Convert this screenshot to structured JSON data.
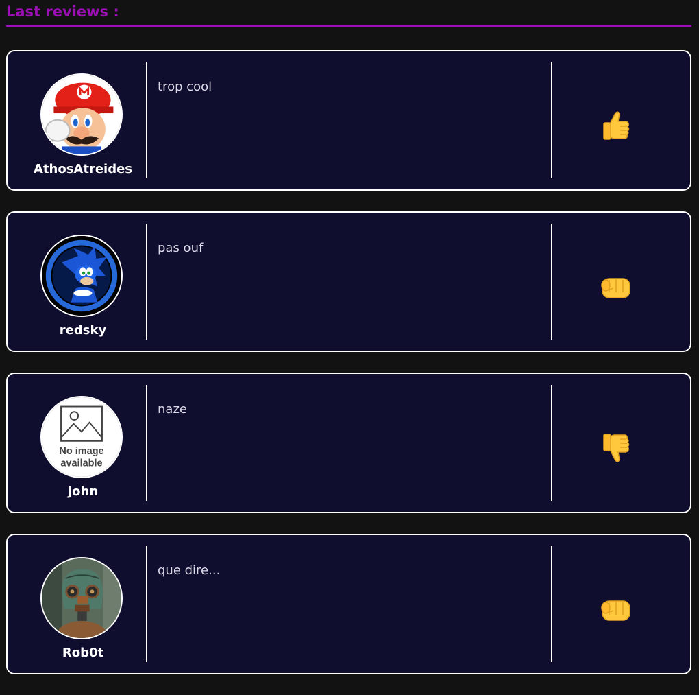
{
  "page": {
    "title": "Last reviews :",
    "accent_color": "#9c0fb6"
  },
  "reviews": [
    {
      "username": "AthosAtreides",
      "comment": "trop cool",
      "reaction_icon": "thumbs-up-icon",
      "avatar": "mario-avatar"
    },
    {
      "username": "redsky",
      "comment": "pas ouf",
      "reaction_icon": "fist-icon",
      "avatar": "sonic-avatar"
    },
    {
      "username": "john",
      "comment": "naze",
      "reaction_icon": "thumbs-down-icon",
      "avatar": "no-image-avatar",
      "avatar_text": [
        "No image",
        "available"
      ]
    },
    {
      "username": "Rob0t",
      "comment": "que dire...",
      "reaction_icon": "fist-icon",
      "avatar": "robot-avatar"
    }
  ]
}
